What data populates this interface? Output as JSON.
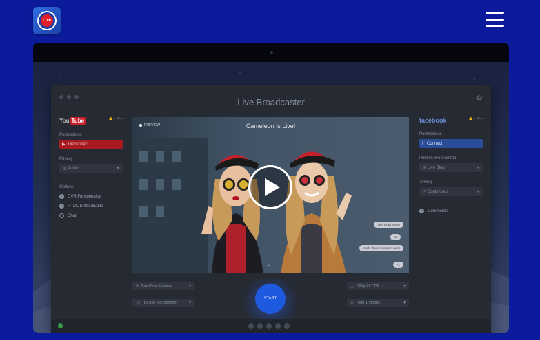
{
  "header": {
    "logo_text": "Live",
    "menu_icon": "hamburger-icon"
  },
  "app": {
    "title": "Live Broadcaster",
    "settings_icon": "gear-icon"
  },
  "youtube": {
    "logo_prefix": "You",
    "logo_suffix": "Tube",
    "permissions_label": "Permissions",
    "disconnect_label": "Disconnect",
    "privacy_label": "Privacy",
    "privacy_value": "Public",
    "options_label": "Options",
    "options": [
      {
        "label": "DVR Functionality",
        "checked": true
      },
      {
        "label": "HTML Embeddable",
        "checked": true
      },
      {
        "label": "Chat",
        "checked": false
      }
    ]
  },
  "video": {
    "preview_label": "PREVIEW",
    "caption": "Cameleon is Live!",
    "comments": [
      "This looks great!",
      "<3",
      "Yeah, those sweaters rock!",
      "+1"
    ]
  },
  "facebook": {
    "logo": "facebook",
    "permissions_label": "Permissions",
    "connect_label": "Connect",
    "publish_label": "Publish live event to",
    "publish_value": "Live Blog",
    "timing_label": "Timing",
    "timing_value": "Continuous",
    "comments_label": "Comments"
  },
  "controls": {
    "camera": "FaceTime Camera",
    "microphone": "Built-in Microphone",
    "resolution": "720p 30 FPS",
    "bitrate": "High 1.5Mbps",
    "start_label": "START"
  },
  "colors": {
    "background": "#0c1b9c",
    "youtube_red": "#a81a20",
    "facebook_blue": "#2a4d9a",
    "start_blue": "#1e5ae0"
  }
}
